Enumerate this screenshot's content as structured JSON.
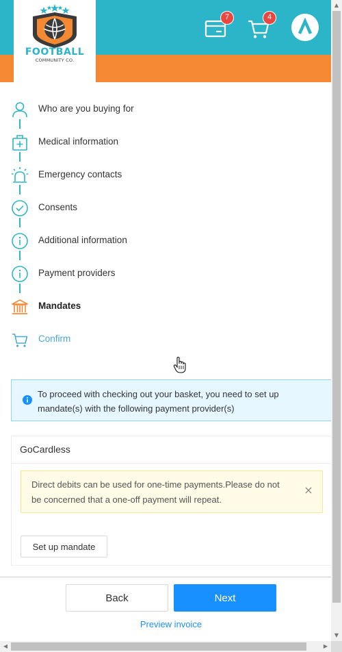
{
  "colors": {
    "brand_teal": "#2cb5c9",
    "brand_orange": "#f58833",
    "badge_red": "#e8483f",
    "primary_blue": "#1890ff",
    "info_bg": "#e6f7ff",
    "warning_bg": "#fffbe6"
  },
  "header": {
    "logo": {
      "title": "FOOTBALL",
      "subtitle": "COMMUNITY CO."
    },
    "invoices_icon": "card-icon",
    "invoices_badge": "7",
    "cart_icon": "cart-icon",
    "cart_badge": "4",
    "avatar_icon": "caret-up-icon"
  },
  "steps": [
    {
      "label": "Who are you buying for",
      "icon": "user-icon",
      "state": "done"
    },
    {
      "label": "Medical information",
      "icon": "medical-kit-icon",
      "state": "done"
    },
    {
      "label": "Emergency contacts",
      "icon": "alarm-icon",
      "state": "done"
    },
    {
      "label": "Consents",
      "icon": "check-circle-icon",
      "state": "done"
    },
    {
      "label": "Additional information",
      "icon": "info-circle-icon",
      "state": "done"
    },
    {
      "label": "Payment providers",
      "icon": "info-circle-icon",
      "state": "done"
    },
    {
      "label": "Mandates",
      "icon": "bank-icon",
      "state": "active"
    },
    {
      "label": "Confirm",
      "icon": "cart-icon",
      "state": "upcoming"
    }
  ],
  "info_message": "To proceed with checking out your basket, you need to set up mandate(s) with the following payment provider(s)",
  "provider": {
    "name": "GoCardless",
    "warning": "Direct debits can be used for one-time payments.Please do not be concerned that a one-off payment will repeat.",
    "setup_button": "Set up mandate"
  },
  "footer": {
    "back_label": "Back",
    "next_label": "Next",
    "preview_label": "Preview invoice"
  }
}
